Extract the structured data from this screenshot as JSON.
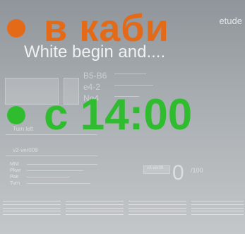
{
  "overlay": {
    "line1": "в каби",
    "line2": "с 14:00",
    "colors": {
      "line1": "#e46a18",
      "line2": "#2fbc2f"
    }
  },
  "background": {
    "etude": "etude",
    "headline": "White begin and....",
    "codes": [
      "B5-B6",
      "e4-2",
      "Ng4"
    ],
    "turn_label": "Turn left",
    "version": "v2-ver009",
    "fields": [
      "MNI",
      "Pkwr",
      "Pair",
      "Turn"
    ],
    "box_label": "v3-ver09",
    "score": "0",
    "score_max": "/100"
  }
}
